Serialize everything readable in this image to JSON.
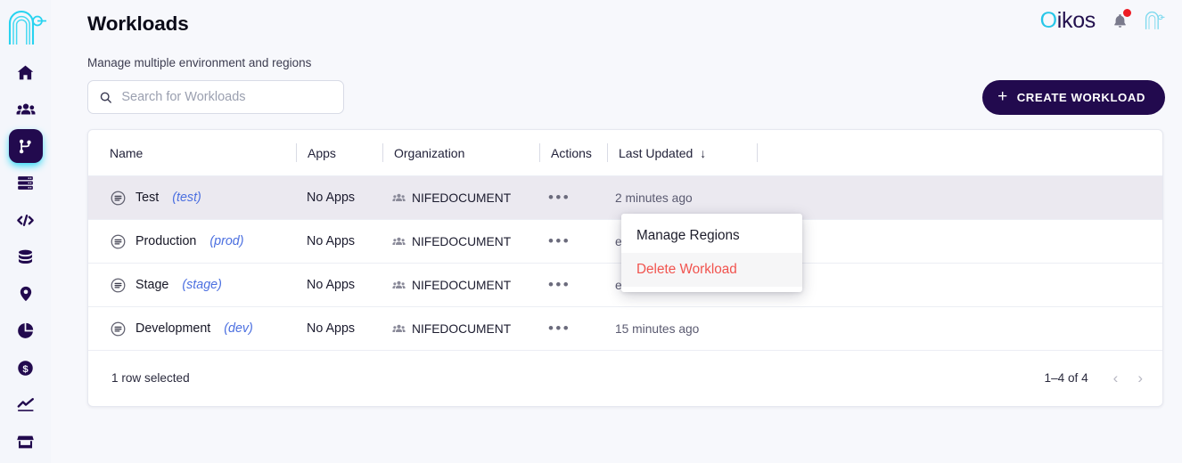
{
  "brand": {
    "word_first": "O",
    "word_rest": "ikos",
    "accent_color": "#27c6e8",
    "dark_color": "#23114e",
    "notification_dot_color": "#ee1c25"
  },
  "sidebar": {
    "logo_name": "oikos-arch-logo",
    "items": [
      {
        "name": "home",
        "icon": "home-icon",
        "active": false
      },
      {
        "name": "teams",
        "icon": "users-group-icon",
        "active": false
      },
      {
        "name": "workloads",
        "icon": "git-branch-icon",
        "active": true
      },
      {
        "name": "servers",
        "icon": "server-stack-icon",
        "active": false
      },
      {
        "name": "code",
        "icon": "code-brackets-icon",
        "active": false
      },
      {
        "name": "databases",
        "icon": "database-icon",
        "active": false
      },
      {
        "name": "regions",
        "icon": "location-pin-icon",
        "active": false
      },
      {
        "name": "analytics",
        "icon": "pie-chart-icon",
        "active": false
      },
      {
        "name": "billing",
        "icon": "dollar-circle-icon",
        "active": false
      },
      {
        "name": "metrics",
        "icon": "line-chart-icon",
        "active": false
      },
      {
        "name": "marketplace",
        "icon": "store-icon",
        "active": false
      }
    ]
  },
  "header": {
    "title": "Workloads",
    "subtitle": "Manage multiple environment and regions"
  },
  "search": {
    "placeholder": "Search for Workloads",
    "value": "",
    "icon": "search-icon"
  },
  "create_button": {
    "label": "CREATE WORKLOAD",
    "plus": "+",
    "bg_color": "#220a4e"
  },
  "table": {
    "columns": [
      {
        "key": "name",
        "label": "Name"
      },
      {
        "key": "apps",
        "label": "Apps"
      },
      {
        "key": "organization",
        "label": "Organization"
      },
      {
        "key": "actions",
        "label": "Actions"
      },
      {
        "key": "last_updated",
        "label": "Last Updated",
        "sort": "↓"
      }
    ],
    "rows": [
      {
        "icon": "list-circle-icon",
        "name": "Test",
        "slug": "(test)",
        "apps": "No Apps",
        "org_icon": "users-group-icon",
        "organization": "NIFEDOCUMENT",
        "actions": "•••",
        "last_updated": "2 minutes ago",
        "selected": true
      },
      {
        "icon": "list-circle-icon",
        "name": "Production",
        "slug": "(prod)",
        "apps": "No Apps",
        "org_icon": "users-group-icon",
        "organization": "NIFEDOCUMENT",
        "actions": "•••",
        "last_updated": "es ago",
        "selected": false
      },
      {
        "icon": "list-circle-icon",
        "name": "Stage",
        "slug": "(stage)",
        "apps": "No Apps",
        "org_icon": "users-group-icon",
        "organization": "NIFEDOCUMENT",
        "actions": "•••",
        "last_updated": "es ago",
        "selected": false
      },
      {
        "icon": "list-circle-icon",
        "name": "Development",
        "slug": "(dev)",
        "apps": "No Apps",
        "org_icon": "users-group-icon",
        "organization": "NIFEDOCUMENT",
        "actions": "•••",
        "last_updated": "15 minutes ago",
        "selected": false
      }
    ],
    "footer": {
      "selection_text": "1 row selected",
      "page_range": "1–4 of 4",
      "prev_glyph": "‹",
      "next_glyph": "›"
    }
  },
  "context_menu": {
    "visible": true,
    "items": [
      {
        "label": "Manage Regions",
        "danger": false
      },
      {
        "label": "Delete Workload",
        "danger": true
      }
    ],
    "danger_color": "#f1534e"
  }
}
